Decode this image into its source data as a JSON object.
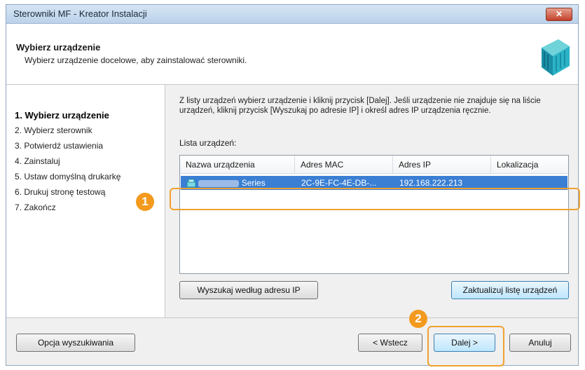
{
  "window": {
    "title": "Sterowniki MF - Kreator Instalacji",
    "close_glyph": "✕"
  },
  "header": {
    "title": "Wybierz urządzenie",
    "subtitle": "Wybierz urządzenie docelowe, aby zainstalować sterowniki.",
    "icon": "printer-driver-icon"
  },
  "steps": [
    {
      "label": "1.  Wybierz urządzenie",
      "active": true
    },
    {
      "label": "2.  Wybierz sterownik"
    },
    {
      "label": "3.  Potwierdź ustawienia"
    },
    {
      "label": "4.  Zainstaluj"
    },
    {
      "label": "5.  Ustaw domyślną drukarkę"
    },
    {
      "label": "6.  Drukuj stronę testową"
    },
    {
      "label": "7.  Zakończ"
    }
  ],
  "content": {
    "description": "Z listy urządzeń wybierz urządzenie i kliknij przycisk [Dalej]. Jeśli urządzenie nie znajduje się na liście urządzeń, kliknij przycisk [Wyszukaj po adresie IP] i określ adres IP urządzenia ręcznie.",
    "list_label": "Lista urządzeń:",
    "columns": [
      "Nazwa urządzenia",
      "Adres MAC",
      "Adres IP",
      "Lokalizacja"
    ],
    "rows": [
      {
        "name": "Series",
        "mac": "2C-9E-FC-4E-DB-...",
        "ip": "192.168.222.213",
        "location": ""
      }
    ],
    "search_ip_button": "Wyszukaj według adresu IP",
    "refresh_button": "Zaktualizuj listę urządzeń"
  },
  "footer": {
    "search_options_button": "Opcja wyszukiwania",
    "back_button": "< Wstecz",
    "next_button": "Dalej >",
    "cancel_button": "Anuluj"
  },
  "callouts": [
    "1",
    "2"
  ],
  "colors": {
    "selection": "#3a7fd4",
    "callout": "#f39a1e"
  }
}
